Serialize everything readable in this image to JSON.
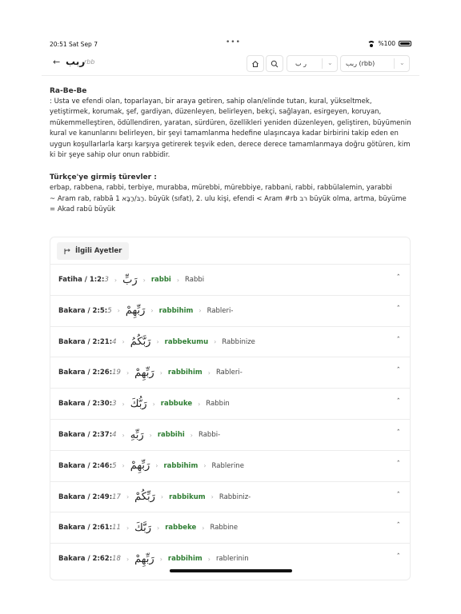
{
  "status": {
    "time": "20:51  Sat Sep 7",
    "battery": "%100"
  },
  "nav": {
    "title_arabic": "ربب",
    "title_latin": "rbb",
    "root_value": "ر ب",
    "word_value": "ربب (rbb)"
  },
  "entry": {
    "heading": "Ra-Be-Be",
    "definition": ": Usta ve efendi olan, toparlayan, bir araya getiren, sahip olan/elinde tutan, kural, yükseltmek, yetiştirmek, korumak, şef, gardiyan, düzenleyen, belirleyen, bekçi, sağlayan, esirgeyen, koruyan, mükemmelleştiren, ödüllendiren, yaratan, sürdüren, özellikleri yeniden düzenleyen, geliştiren, büyümenin kural ve kanunlarını belirleyen, bir şeyi tamamlanma hedefine ulaşıncaya kadar birbirini takip eden en uygun koşullarlarla karşı karşıya getirerek teşvik eden, derece derece tamamlanmaya doğru götüren, kim ki bir şeye sahip olur onun rabbidir.",
    "derived_heading": "Türkçe'ye girmiş türevler :",
    "derived_words": "erbap, rabbena, rabbi, terbiye, murabba, mürebbi, mürebbiye, rabbani, rabbi, rabbülalemin, yarabbi",
    "etymology": "~ Aram rab, rabbā 1 רַבּ/רַבָּא. büyük (sıfat), 2. ulu kişi, efendi < Aram #rb רב büyük olma, artma, büyüme = Akad rabū büyük"
  },
  "related": {
    "button_label": "İlgili Ayetler",
    "rows": [
      {
        "ref": "Fatiha / 1:2:",
        "word_no": "3",
        "arabic": "رَبِّ",
        "translit": "rabbi",
        "meaning": "Rabbi"
      },
      {
        "ref": "Bakara / 2:5:",
        "word_no": "5",
        "arabic": "رَبِّهِمْ",
        "translit": "rabbihim",
        "meaning": "Rableri-"
      },
      {
        "ref": "Bakara / 2:21:",
        "word_no": "4",
        "arabic": "رَبَّكُمُ",
        "translit": "rabbekumu",
        "meaning": "Rabbinize"
      },
      {
        "ref": "Bakara / 2:26:",
        "word_no": "19",
        "arabic": "رَبِّهِمْ",
        "translit": "rabbihim",
        "meaning": "Rableri-"
      },
      {
        "ref": "Bakara / 2:30:",
        "word_no": "3",
        "arabic": "رَبُّكَ",
        "translit": "rabbuke",
        "meaning": "Rabbin"
      },
      {
        "ref": "Bakara / 2:37:",
        "word_no": "4",
        "arabic": "رَبِّهِ",
        "translit": "rabbihi",
        "meaning": "Rabbi-"
      },
      {
        "ref": "Bakara / 2:46:",
        "word_no": "5",
        "arabic": "رَبِّهِمْ",
        "translit": "rabbihim",
        "meaning": "Rablerine"
      },
      {
        "ref": "Bakara / 2:49:",
        "word_no": "17",
        "arabic": "رَبِّكُمْ",
        "translit": "rabbikum",
        "meaning": "Rabbiniz-"
      },
      {
        "ref": "Bakara / 2:61:",
        "word_no": "11",
        "arabic": "رَبَّكَ",
        "translit": "rabbeke",
        "meaning": "Rabbine"
      },
      {
        "ref": "Bakara / 2:62:",
        "word_no": "18",
        "arabic": "رَبِّهِمْ",
        "translit": "rabbihim",
        "meaning": "rablerinin"
      }
    ]
  }
}
